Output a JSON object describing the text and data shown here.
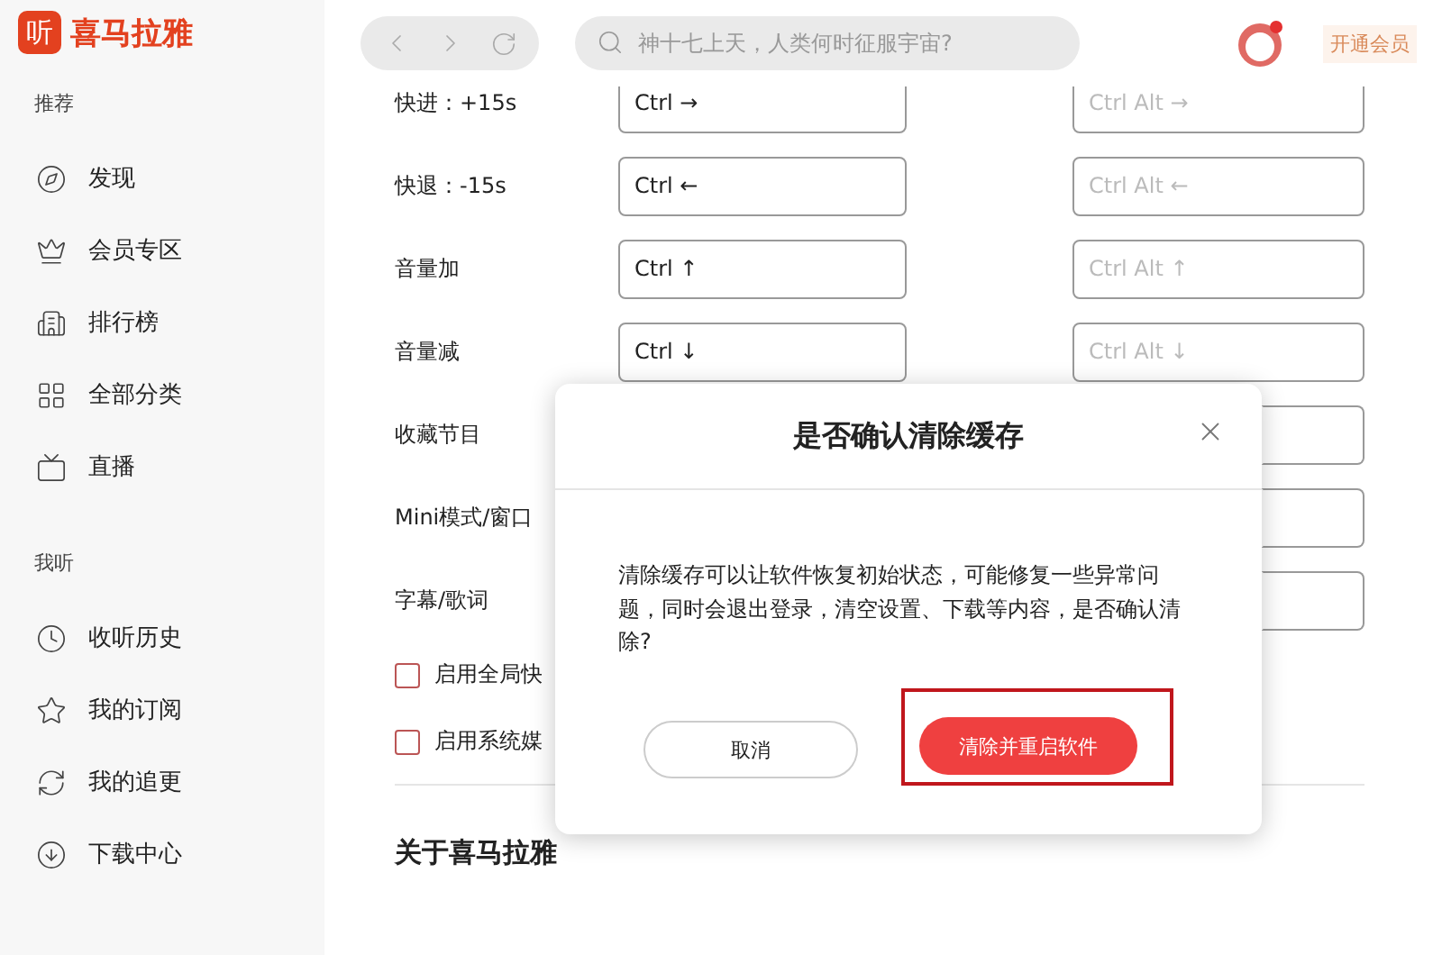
{
  "app": {
    "logo_glyph": "听",
    "name": "喜马拉雅"
  },
  "sidebar": {
    "sections": [
      {
        "title": "推荐",
        "items": [
          {
            "label": "发现"
          },
          {
            "label": "会员专区"
          },
          {
            "label": "排行榜"
          },
          {
            "label": "全部分类"
          },
          {
            "label": "直播"
          }
        ]
      },
      {
        "title": "我听",
        "items": [
          {
            "label": "收听历史"
          },
          {
            "label": "我的订阅"
          },
          {
            "label": "我的追更"
          },
          {
            "label": "下载中心"
          }
        ]
      }
    ]
  },
  "topbar": {
    "search": {
      "placeholder": "神十七上天，人类何时征服宇宙?"
    },
    "vip_button": "开通会员"
  },
  "shortcuts": [
    {
      "label": "快进：+15s",
      "key": "Ctrl →",
      "global": "Ctrl Alt →"
    },
    {
      "label": "快退：-15s",
      "key": "Ctrl ←",
      "global": "Ctrl Alt ←"
    },
    {
      "label": "音量加",
      "key": "Ctrl ↑",
      "global": "Ctrl Alt ↑"
    },
    {
      "label": "音量减",
      "key": "Ctrl ↓",
      "global": "Ctrl Alt ↓"
    },
    {
      "label": "收藏节目"
    },
    {
      "label": "Mini模式/窗口"
    },
    {
      "label": "字幕/歌词"
    }
  ],
  "options": [
    {
      "label": "启用全局快",
      "checked": false
    },
    {
      "label": "启用系统媒",
      "checked": false
    }
  ],
  "about_heading": "关于喜马拉雅",
  "dialog": {
    "title": "是否确认清除缓存",
    "message": "清除缓存可以让软件恢复初始状态，可能修复一些异常问题，同时会退出登录，清空设置、下载等内容，是否确认清除?",
    "cancel": "取消",
    "confirm": "清除并重启软件",
    "confirm_highlighted": true
  }
}
